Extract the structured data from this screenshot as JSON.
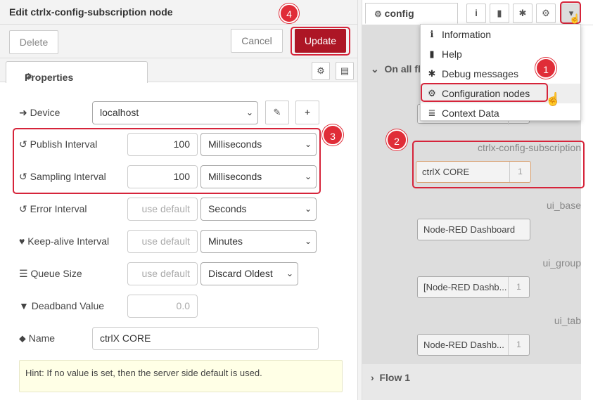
{
  "editor": {
    "title": "Edit ctrlx-config-subscription node",
    "delete_label": "Delete",
    "cancel_label": "Cancel",
    "update_label": "Update",
    "tab_properties": "Properties",
    "fields": {
      "device_label": "Device",
      "device_value": "localhost",
      "publish_label": "Publish Interval",
      "publish_value": "100",
      "publish_unit": "Milliseconds",
      "sampling_label": "Sampling Interval",
      "sampling_value": "100",
      "sampling_unit": "Milliseconds",
      "error_label": "Error Interval",
      "error_placeholder": "use default",
      "error_unit": "Seconds",
      "keepalive_label": "Keep-alive Interval",
      "keepalive_placeholder": "use default",
      "keepalive_unit": "Minutes",
      "queue_label": "Queue Size",
      "queue_placeholder": "use default",
      "queue_mode": "Discard Oldest",
      "deadband_label": "Deadband Value",
      "deadband_placeholder": "0.0",
      "name_label": "Name",
      "name_value": "ctrlX CORE"
    },
    "hint": "Hint: If no value is set, then the server side default is used."
  },
  "sidebar": {
    "tab_label": "config",
    "section_onall": "On all flows",
    "section_flow1": "Flow 1",
    "menu": [
      {
        "label": "Information",
        "icon": "info-icon"
      },
      {
        "label": "Help",
        "icon": "book-icon"
      },
      {
        "label": "Debug messages",
        "icon": "bug-icon"
      },
      {
        "label": "Configuration nodes",
        "icon": "gear-icon"
      },
      {
        "label": "Context Data",
        "icon": "database-icon"
      }
    ],
    "groups": [
      {
        "type": "ctrlx-config-subscription",
        "node": "ctrlX CORE",
        "count": "1"
      },
      {
        "type": "ui_base",
        "node": "Node-RED Dashboard",
        "count": ""
      },
      {
        "type": "ui_group",
        "node": "[Node-RED Dashb...",
        "count": "1"
      },
      {
        "type": "ui_tab",
        "node": "Node-RED Dashb...",
        "count": "1"
      }
    ],
    "hidden_node_count": "1"
  },
  "callouts": [
    "1",
    "2",
    "3",
    "4"
  ],
  "colors": {
    "accent": "#ad1625",
    "callout": "#e02d38"
  }
}
